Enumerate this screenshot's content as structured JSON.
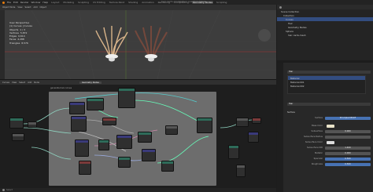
{
  "window_title": "hair cards-modelation question.blend",
  "menus": [
    "File",
    "Edit",
    "Render",
    "Window",
    "Help"
  ],
  "workspaces": [
    "Layout",
    "Modeling",
    "Sculpting",
    "UV Editing",
    "Texture Paint",
    "Shading",
    "Animation",
    "Rendering",
    "Compositing",
    "Geometry Nodes",
    "Scripting"
  ],
  "active_workspace": "Geometry Nodes",
  "viewport": {
    "header_items": [
      "Object Mode",
      "View",
      "Select",
      "Add",
      "Object"
    ],
    "stats_lines": [
      "User Perspective",
      "(1) Curves | Curves",
      "Objects  1 / 3",
      "Vertices  5,872",
      "Edges  9,614",
      "Faces  4,288",
      "Triangles  8,576"
    ]
  },
  "node_editor": {
    "header_items": [
      "Curves",
      "View",
      "Select",
      "Add",
      "Node"
    ],
    "node_group": "Geometry Nodes",
    "breadcrumb": "generate-hair-curves",
    "node_labels": [
      "Set Position",
      "Curve to Mesh",
      "Resample Curve",
      "Realize Instances",
      "Join Geometry",
      "Group Output"
    ]
  },
  "outliner": {
    "items": [
      "Scene Collection",
      "Collection",
      "Curves",
      "Hair",
      "Geometry Nodes",
      "Sphere",
      "hair cards-mesh"
    ],
    "selected_index": 2
  },
  "properties": {
    "object_name": "Hair",
    "material_slots": [
      "Material",
      "Material.001",
      "Material.002"
    ],
    "material_name": "Hair",
    "surface_label": "Surface",
    "shader": "Principled BSDF",
    "rows": [
      {
        "label": "Base Color",
        "value": ""
      },
      {
        "label": "Subsurface",
        "value": "0.000"
      },
      {
        "label": "Subsurface Radius",
        "value": ""
      },
      {
        "label": "Subsurface Color",
        "value": ""
      },
      {
        "label": "Subsurface IOR",
        "value": "1.400"
      },
      {
        "label": "Metallic",
        "value": "0.000"
      },
      {
        "label": "Specular",
        "value": "0.500"
      },
      {
        "label": "Roughness",
        "value": "0.500"
      }
    ]
  },
  "status_bar": "Select"
}
